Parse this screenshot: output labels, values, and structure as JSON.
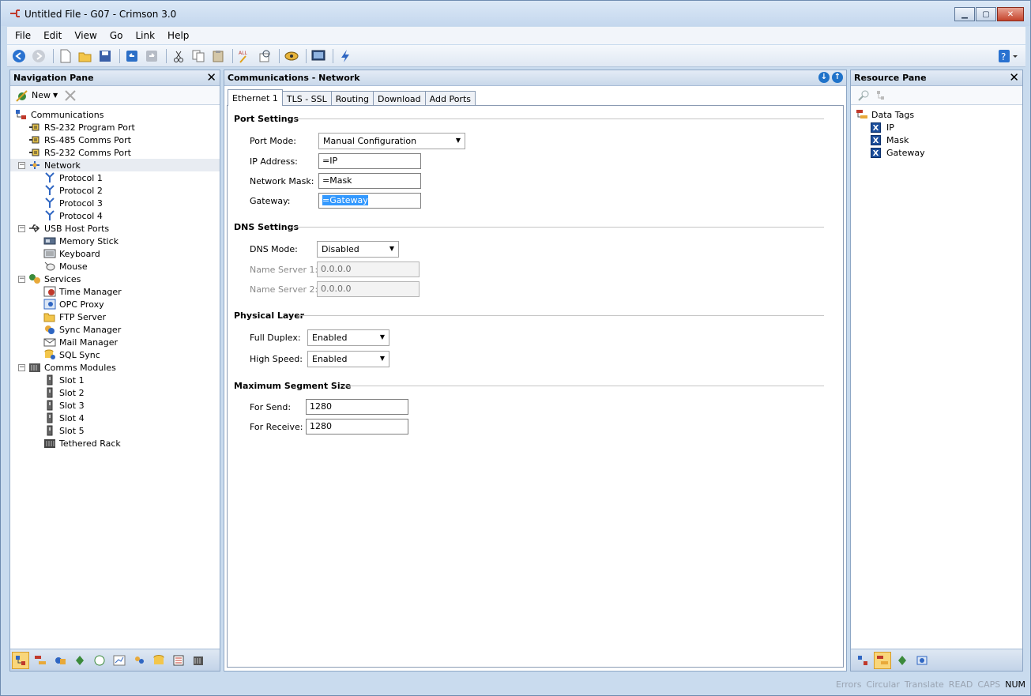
{
  "window": {
    "title": "Untitled File - G07 - Crimson 3.0"
  },
  "menu": [
    "File",
    "Edit",
    "View",
    "Go",
    "Link",
    "Help"
  ],
  "navigation": {
    "title": "Navigation Pane",
    "new_label": "New",
    "tree": [
      {
        "label": "Communications",
        "level": 0,
        "icon": "comms-icon"
      },
      {
        "label": "RS-232 Program Port",
        "level": 1,
        "icon": "port-icon"
      },
      {
        "label": "RS-485 Comms Port",
        "level": 1,
        "icon": "port-icon"
      },
      {
        "label": "RS-232 Comms Port",
        "level": 1,
        "icon": "port-icon"
      },
      {
        "label": "Network",
        "level": 1,
        "icon": "network-icon",
        "expander": "−",
        "selected": true
      },
      {
        "label": "Protocol 1",
        "level": 2,
        "icon": "protocol-icon"
      },
      {
        "label": "Protocol 2",
        "level": 2,
        "icon": "protocol-icon"
      },
      {
        "label": "Protocol 3",
        "level": 2,
        "icon": "protocol-icon"
      },
      {
        "label": "Protocol 4",
        "level": 2,
        "icon": "protocol-icon"
      },
      {
        "label": "USB Host Ports",
        "level": 1,
        "icon": "usb-icon",
        "expander": "−"
      },
      {
        "label": "Memory Stick",
        "level": 2,
        "icon": "memory-stick-icon"
      },
      {
        "label": "Keyboard",
        "level": 2,
        "icon": "keyboard-icon"
      },
      {
        "label": "Mouse",
        "level": 2,
        "icon": "mouse-icon"
      },
      {
        "label": "Services",
        "level": 1,
        "icon": "services-icon",
        "expander": "−"
      },
      {
        "label": "Time Manager",
        "level": 2,
        "icon": "time-manager-icon"
      },
      {
        "label": "OPC Proxy",
        "level": 2,
        "icon": "opc-proxy-icon"
      },
      {
        "label": "FTP Server",
        "level": 2,
        "icon": "ftp-server-icon"
      },
      {
        "label": "Sync Manager",
        "level": 2,
        "icon": "sync-manager-icon"
      },
      {
        "label": "Mail Manager",
        "level": 2,
        "icon": "mail-manager-icon"
      },
      {
        "label": "SQL Sync",
        "level": 2,
        "icon": "sql-sync-icon"
      },
      {
        "label": "Comms Modules",
        "level": 1,
        "icon": "comms-modules-icon",
        "expander": "−"
      },
      {
        "label": "Slot 1",
        "level": 2,
        "icon": "slot-icon"
      },
      {
        "label": "Slot 2",
        "level": 2,
        "icon": "slot-icon"
      },
      {
        "label": "Slot 3",
        "level": 2,
        "icon": "slot-icon"
      },
      {
        "label": "Slot 4",
        "level": 2,
        "icon": "slot-icon"
      },
      {
        "label": "Slot 5",
        "level": 2,
        "icon": "slot-icon"
      },
      {
        "label": "Tethered Rack",
        "level": 2,
        "icon": "rack-icon"
      }
    ]
  },
  "main": {
    "title": "Communications - Network",
    "tabs": [
      "Ethernet 1",
      "TLS - SSL",
      "Routing",
      "Download",
      "Add Ports"
    ],
    "active_tab": 0,
    "port_settings": {
      "heading": "Port Settings",
      "port_mode_label": "Port Mode:",
      "port_mode_value": "Manual Configuration",
      "ip_label": "IP Address:",
      "ip_value": "=IP",
      "mask_label": "Network Mask:",
      "mask_value": "=Mask",
      "gateway_label": "Gateway:",
      "gateway_value": "=Gateway"
    },
    "dns_settings": {
      "heading": "DNS Settings",
      "mode_label": "DNS Mode:",
      "mode_value": "Disabled",
      "ns1_label": "Name Server 1:",
      "ns1_value": "0.0.0.0",
      "ns2_label": "Name Server 2:",
      "ns2_value": "0.0.0.0"
    },
    "physical_layer": {
      "heading": "Physical Layer",
      "duplex_label": "Full Duplex:",
      "duplex_value": "Enabled",
      "speed_label": "High Speed:",
      "speed_value": "Enabled"
    },
    "mss": {
      "heading": "Maximum Segment Size",
      "send_label": "For Send:",
      "send_value": "1280",
      "receive_label": "For Receive:",
      "receive_value": "1280"
    }
  },
  "resource": {
    "title": "Resource Pane",
    "root": "Data Tags",
    "items": [
      "IP",
      "Mask",
      "Gateway"
    ]
  },
  "status": {
    "items": [
      "Errors",
      "Circular",
      "Translate",
      "READ",
      "CAPS",
      "NUM"
    ],
    "active": [
      "NUM"
    ]
  }
}
